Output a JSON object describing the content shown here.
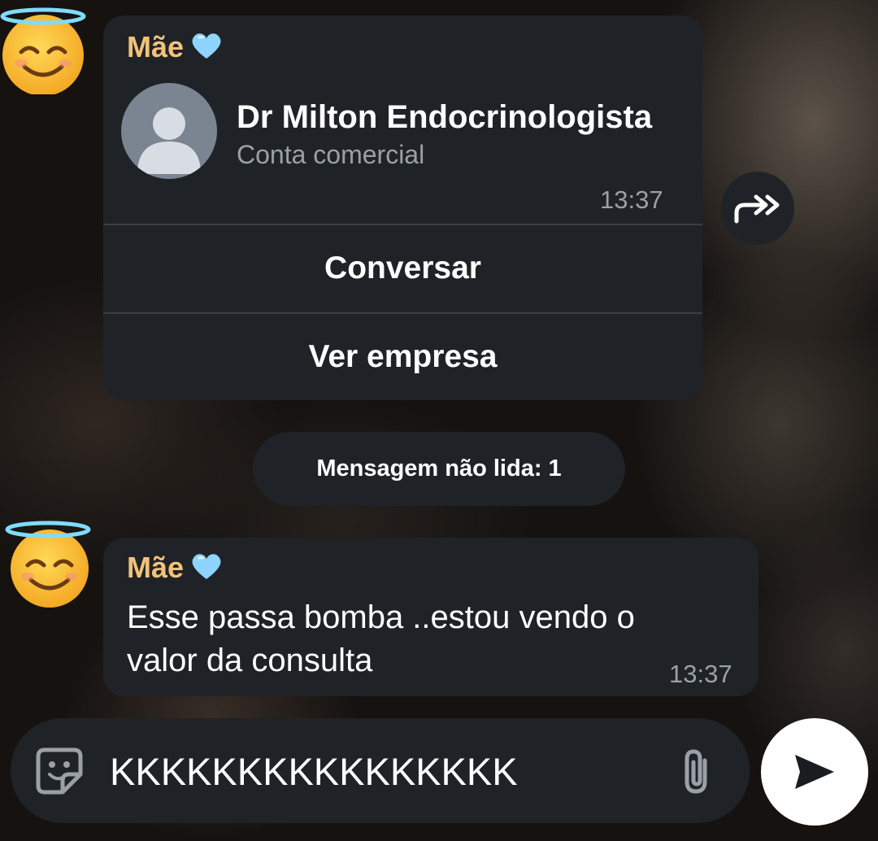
{
  "colors": {
    "bubble": "#1f2327",
    "sender_name": "#f2c27a",
    "time": "#9aa0a6",
    "text": "#ffffff",
    "avatar_bg": "#7a8591",
    "heart": "#8fd3ff"
  },
  "contact_card_message": {
    "sender_name": "Mãe",
    "sender_emoji": "smiling-face-with-halo",
    "sender_heart": "light-blue-heart",
    "contact_name": "Dr Milton Endocrinologista",
    "contact_subtitle": "Conta comercial",
    "time": "13:37",
    "actions": [
      "Conversar",
      "Ver empresa"
    ],
    "forward_icon": "forward-icon"
  },
  "unread_divider": {
    "label": "Mensagem não lida: 1"
  },
  "text_message": {
    "sender_name": "Mãe",
    "sender_emoji": "smiling-face-with-halo",
    "sender_heart": "light-blue-heart",
    "lines": [
      "Esse passa bomba ..estou vendo o",
      "valor da consulta"
    ],
    "time": "13:37"
  },
  "composer": {
    "value": "KKKKKKKKKKKKKKKK",
    "sticker_icon": "sticker-icon",
    "attach_icon": "paperclip-icon",
    "send_icon": "send-icon"
  }
}
